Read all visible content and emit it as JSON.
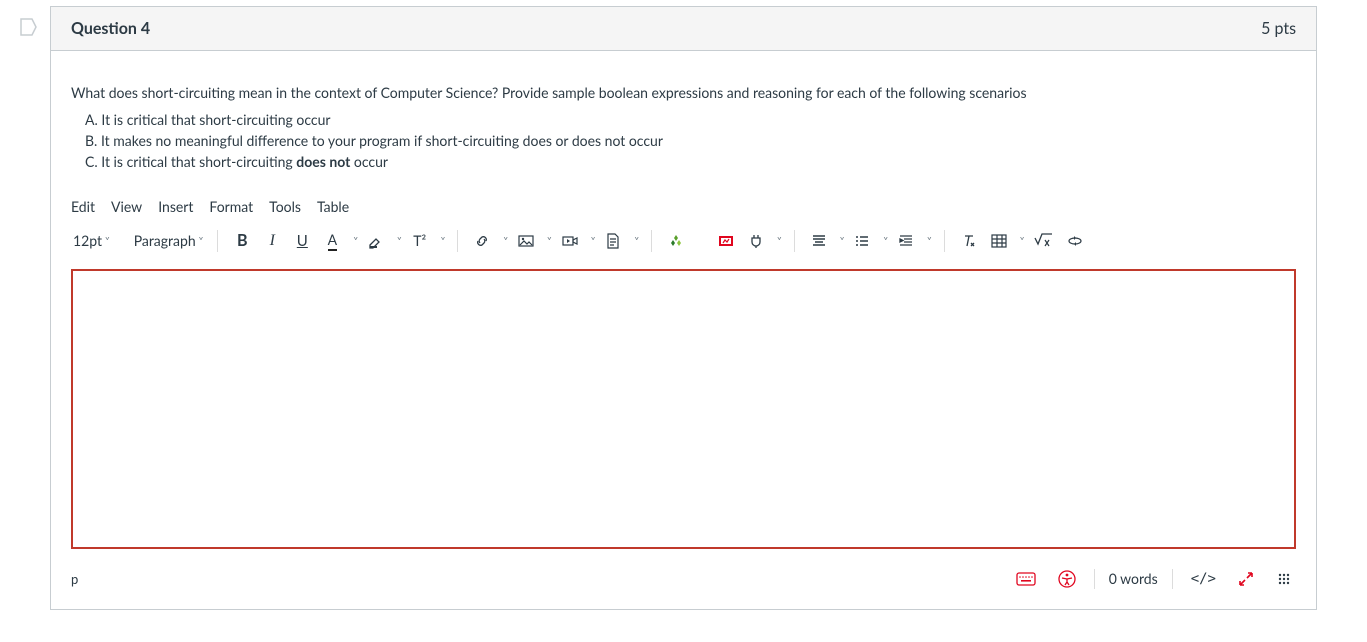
{
  "header": {
    "title": "Question 4",
    "points": "5 pts"
  },
  "question": {
    "prompt": "What does short-circuiting mean in the context of Computer Science? Provide sample boolean expressions and reasoning for each of the following scenarios",
    "optA_pre": "A. It is critical that short-circuiting occur",
    "optB_pre": "B. It makes no meaningful difference to your program if short-circuiting does or does not occur",
    "optC_pre": "C. It is critical that short-circuiting ",
    "optC_bold": "does not",
    "optC_post": " occur"
  },
  "menubar": {
    "edit": "Edit",
    "view": "View",
    "insert": "Insert",
    "format": "Format",
    "tools": "Tools",
    "table": "Table"
  },
  "toolbar": {
    "fontsize": "12pt",
    "paragraph": "Paragraph",
    "bold": "B",
    "italic": "I",
    "underline": "U",
    "textcolor": "A",
    "super": "T²"
  },
  "status": {
    "path": "p",
    "words": "0 words",
    "code": "</>"
  }
}
